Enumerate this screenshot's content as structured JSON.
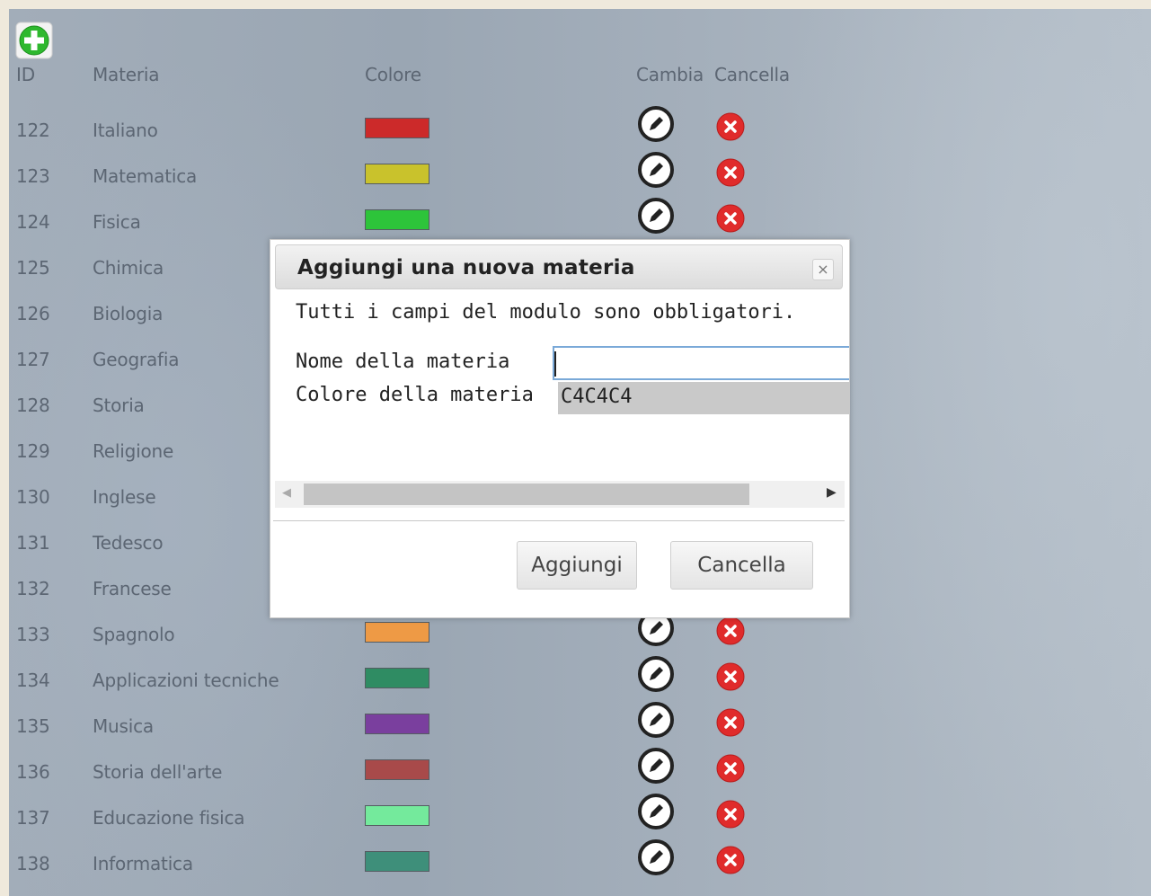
{
  "table": {
    "headers": {
      "id": "ID",
      "subject": "Materia",
      "color": "Colore",
      "edit": "Cambia",
      "delete": "Cancella"
    },
    "rows": [
      {
        "id": "122",
        "name": "Italiano",
        "color": "#cc2a2a"
      },
      {
        "id": "123",
        "name": "Matematica",
        "color": "#c9c22c"
      },
      {
        "id": "124",
        "name": "Fisica",
        "color": "#2dc43a"
      },
      {
        "id": "125",
        "name": "Chimica",
        "color": null
      },
      {
        "id": "126",
        "name": "Biologia",
        "color": null
      },
      {
        "id": "127",
        "name": "Geografia",
        "color": null
      },
      {
        "id": "128",
        "name": "Storia",
        "color": null
      },
      {
        "id": "129",
        "name": "Religione",
        "color": null
      },
      {
        "id": "130",
        "name": "Inglese",
        "color": null
      },
      {
        "id": "131",
        "name": "Tedesco",
        "color": null
      },
      {
        "id": "132",
        "name": "Francese",
        "color": null
      },
      {
        "id": "133",
        "name": "Spagnolo",
        "color": "#ee9a45"
      },
      {
        "id": "134",
        "name": "Applicazioni tecniche",
        "color": "#2f8c63"
      },
      {
        "id": "135",
        "name": "Musica",
        "color": "#7a3f9e"
      },
      {
        "id": "136",
        "name": "Storia dell'arte",
        "color": "#a84a4a"
      },
      {
        "id": "137",
        "name": "Educazione fisica",
        "color": "#74ea9c"
      },
      {
        "id": "138",
        "name": "Informatica",
        "color": "#3e8f7a"
      }
    ]
  },
  "dialog": {
    "title": "Aggiungi una nuova materia",
    "close": "×",
    "instructions": "Tutti i campi del modulo sono obbligatori.",
    "name_label": "Nome della materia",
    "name_value": "",
    "color_label": "Colore della materia",
    "color_value": "C4C4C4",
    "add_button": "Aggiungi",
    "cancel_button": "Cancella"
  },
  "colors": {
    "accent_add": "#2eb82e",
    "delete": "#e02b2b",
    "input_focus": "#7aa9d8"
  },
  "icons": {
    "add": "plus-circle-icon",
    "edit": "pencil-circle-icon",
    "delete": "x-circle-icon"
  }
}
